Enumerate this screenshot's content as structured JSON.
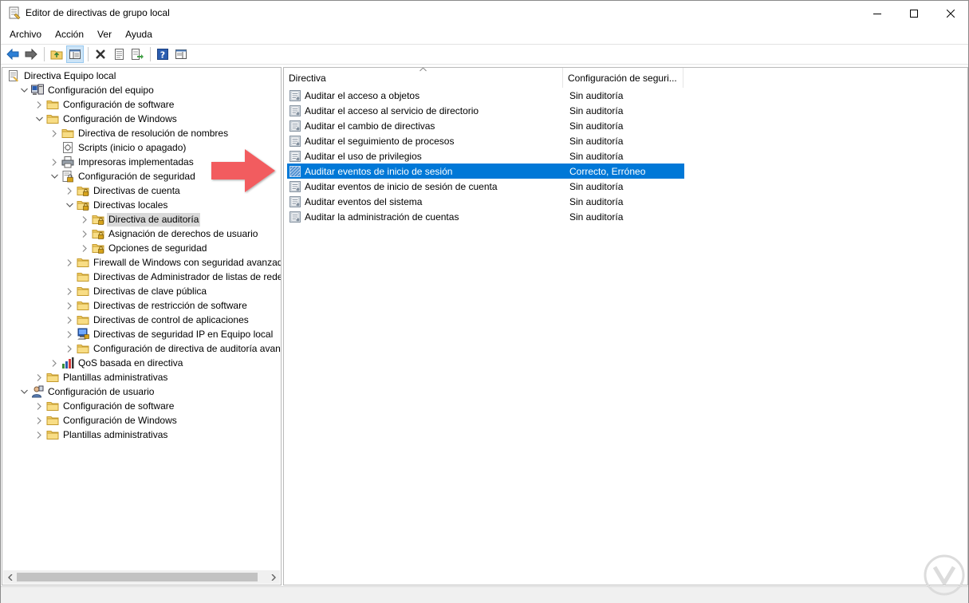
{
  "window": {
    "title": "Editor de directivas de grupo local"
  },
  "menu": [
    "Archivo",
    "Acción",
    "Ver",
    "Ayuda"
  ],
  "tree": [
    {
      "label": "Directiva Equipo local",
      "depth": 0,
      "expander": "none",
      "icon": "policy-doc-icon"
    },
    {
      "label": "Configuración del equipo",
      "depth": 1,
      "expander": "open",
      "icon": "computer-icon"
    },
    {
      "label": "Configuración de software",
      "depth": 2,
      "expander": "closed",
      "icon": "folder-icon"
    },
    {
      "label": "Configuración de Windows",
      "depth": 2,
      "expander": "open",
      "icon": "folder-icon"
    },
    {
      "label": "Directiva de resolución de nombres",
      "depth": 3,
      "expander": "closed",
      "icon": "folder-icon"
    },
    {
      "label": "Scripts (inicio o apagado)",
      "depth": 3,
      "expander": "none",
      "icon": "script-icon"
    },
    {
      "label": "Impresoras implementadas",
      "depth": 3,
      "expander": "closed",
      "icon": "printer-icon"
    },
    {
      "label": "Configuración de seguridad",
      "depth": 3,
      "expander": "open",
      "icon": "security-config-icon"
    },
    {
      "label": "Directivas de cuenta",
      "depth": 4,
      "expander": "closed",
      "icon": "folder-lock-icon"
    },
    {
      "label": "Directivas locales",
      "depth": 4,
      "expander": "open",
      "icon": "folder-lock-icon"
    },
    {
      "label": "Directiva de auditoría",
      "depth": 5,
      "expander": "closed",
      "icon": "folder-lock-icon",
      "selected": true
    },
    {
      "label": "Asignación de derechos de usuario",
      "depth": 5,
      "expander": "closed",
      "icon": "folder-lock-icon"
    },
    {
      "label": "Opciones de seguridad",
      "depth": 5,
      "expander": "closed",
      "icon": "folder-lock-icon"
    },
    {
      "label": "Firewall de Windows con seguridad avanzada",
      "depth": 4,
      "expander": "closed",
      "icon": "folder-icon"
    },
    {
      "label": "Directivas de Administrador de listas de redes",
      "depth": 4,
      "expander": "none",
      "icon": "folder-icon"
    },
    {
      "label": "Directivas de clave pública",
      "depth": 4,
      "expander": "closed",
      "icon": "folder-icon"
    },
    {
      "label": "Directivas de restricción de software",
      "depth": 4,
      "expander": "closed",
      "icon": "folder-icon"
    },
    {
      "label": "Directivas de control de aplicaciones",
      "depth": 4,
      "expander": "closed",
      "icon": "folder-icon"
    },
    {
      "label": "Directivas de seguridad IP en Equipo local",
      "depth": 4,
      "expander": "closed",
      "icon": "ip-security-icon"
    },
    {
      "label": "Configuración de directiva de auditoría avanza",
      "depth": 4,
      "expander": "closed",
      "icon": "folder-icon"
    },
    {
      "label": "QoS basada en directiva",
      "depth": 3,
      "expander": "closed",
      "icon": "qos-chart-icon"
    },
    {
      "label": "Plantillas administrativas",
      "depth": 2,
      "expander": "closed",
      "icon": "folder-icon"
    },
    {
      "label": "Configuración de usuario",
      "depth": 1,
      "expander": "open",
      "icon": "user-icon"
    },
    {
      "label": "Configuración de software",
      "depth": 2,
      "expander": "closed",
      "icon": "folder-icon"
    },
    {
      "label": "Configuración de Windows",
      "depth": 2,
      "expander": "closed",
      "icon": "folder-icon"
    },
    {
      "label": "Plantillas administrativas",
      "depth": 2,
      "expander": "closed",
      "icon": "folder-icon"
    }
  ],
  "list": {
    "columns": [
      "Directiva",
      "Configuración de seguri..."
    ],
    "rows": [
      {
        "policy": "Auditar el acceso a objetos",
        "setting": "Sin auditoría"
      },
      {
        "policy": "Auditar el acceso al servicio de directorio",
        "setting": "Sin auditoría"
      },
      {
        "policy": "Auditar el cambio de directivas",
        "setting": "Sin auditoría"
      },
      {
        "policy": "Auditar el seguimiento de procesos",
        "setting": "Sin auditoría"
      },
      {
        "policy": "Auditar el uso de privilegios",
        "setting": "Sin auditoría"
      },
      {
        "policy": "Auditar eventos de inicio de sesión",
        "setting": "Correcto, Erróneo",
        "selected": true
      },
      {
        "policy": "Auditar eventos de inicio de sesión de cuenta",
        "setting": "Sin auditoría"
      },
      {
        "policy": "Auditar eventos del sistema",
        "setting": "Sin auditoría"
      },
      {
        "policy": "Auditar la administración de cuentas",
        "setting": "Sin auditoría"
      }
    ]
  },
  "colors": {
    "selection": "#0078d7",
    "tree_selection": "#d9d9d9",
    "annotation_arrow": "#f25c5f",
    "folder": "#f3d06b"
  }
}
